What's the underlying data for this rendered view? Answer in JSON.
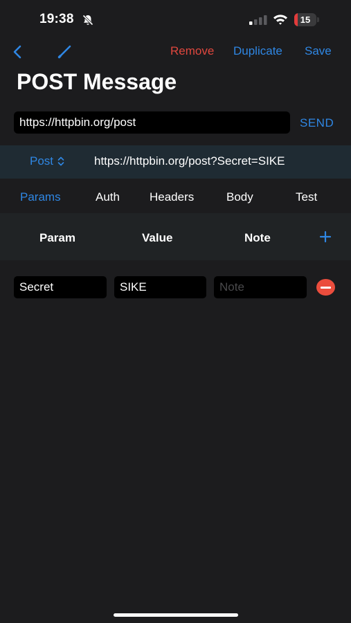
{
  "status_bar": {
    "time": "19:38",
    "battery_level": "15",
    "battery_fraction": 0.15,
    "battery_color": "#e23b3b",
    "icons": [
      "bell-slash-icon",
      "cellular-signal-icon",
      "wifi-icon",
      "battery-icon"
    ]
  },
  "nav": {
    "back_icon": "chevron-left-icon",
    "edit_icon": "pencil-icon",
    "remove_label": "Remove",
    "duplicate_label": "Duplicate",
    "save_label": "Save"
  },
  "title": "POST Message",
  "request": {
    "url_value": "https://httpbin.org/post",
    "send_label": "SEND",
    "method": "Post",
    "full_url": "https://httpbin.org/post?Secret=SIKE"
  },
  "tabs": [
    {
      "label": "Params",
      "active": true
    },
    {
      "label": "Auth",
      "active": false
    },
    {
      "label": "Headers",
      "active": false
    },
    {
      "label": "Body",
      "active": false
    },
    {
      "label": "Test",
      "active": false
    }
  ],
  "params_table": {
    "headers": [
      "Param",
      "Value",
      "Note"
    ],
    "add_icon": "plus-icon",
    "rows": [
      {
        "param": "Secret",
        "value": "SIKE",
        "note": "",
        "note_placeholder": "Note",
        "remove_icon": "minus-circle-icon"
      }
    ]
  },
  "colors": {
    "accent": "#2f87e4",
    "destructive": "#e0473e",
    "background": "#1c1c1e"
  }
}
